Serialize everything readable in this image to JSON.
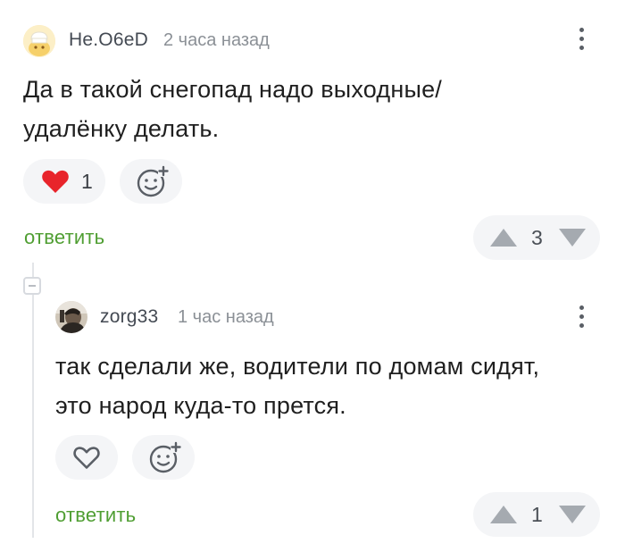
{
  "comments": [
    {
      "author": "He.O6eD",
      "time": "2 часа назад",
      "text_line1": "Да в такой снегопад надо выходные/",
      "text_line2": "удалёнку делать.",
      "likes": "1",
      "reply_label": "ответить",
      "score": "3",
      "liked": true
    },
    {
      "author": "zorg33",
      "time": "1 час назад",
      "text_line1": "так сделали же, водители по домам сидят,",
      "text_line2": "это народ куда-то прется.",
      "likes": "",
      "reply_label": "ответить",
      "score": "1",
      "liked": false
    }
  ],
  "icons": {
    "like_active": "heart-filled-icon",
    "like": "heart-outline-icon",
    "emoji": "emoji-add-icon",
    "upvote": "triangle-up-icon",
    "downvote": "triangle-down-icon",
    "menu": "kebab-menu-icon",
    "collapse": "collapse-thread-icon"
  },
  "colors": {
    "heart": "#e8242b",
    "reply_link": "#4f9e32",
    "pill_bg": "#f4f5f7",
    "vote_arrow": "#a5aab0"
  }
}
